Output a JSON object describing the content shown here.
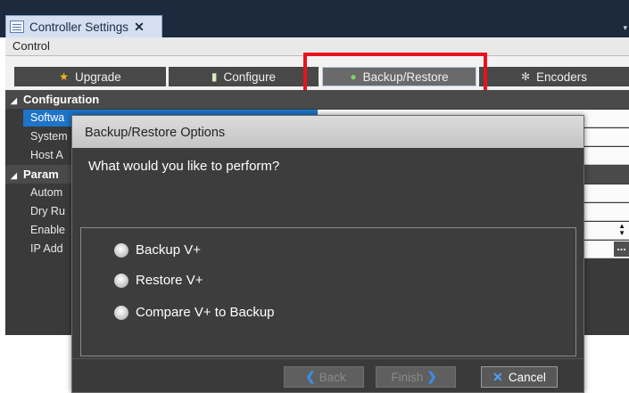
{
  "tab": {
    "title": "Controller Settings",
    "close": "✕",
    "menu": "▾"
  },
  "control_bar": {
    "label": "Control"
  },
  "top_buttons": [
    {
      "label": "Upgrade",
      "icon": "star-icon"
    },
    {
      "label": "Configure",
      "icon": "configure-icon"
    },
    {
      "label": "Backup/Restore",
      "icon": "backup-icon"
    },
    {
      "label": "Encoders",
      "icon": "gear-icon"
    }
  ],
  "grid": {
    "sections": [
      "Configuration",
      "Param"
    ],
    "rows": [
      "Softwa",
      "System",
      "Host A",
      "Autom",
      "Dry Ru",
      "Enable",
      "IP Add"
    ]
  },
  "dialog": {
    "title": "Backup/Restore Options",
    "question": "What would you like to perform?",
    "options": [
      "Backup V+",
      "Restore V+",
      "Compare V+ to Backup"
    ],
    "buttons": {
      "back": "Back",
      "finish": "Finish",
      "cancel": "Cancel"
    }
  },
  "colors": {
    "highlight": "#e8121d",
    "selection": "#1d74c8",
    "accent_icon": "#3a8ee6"
  }
}
